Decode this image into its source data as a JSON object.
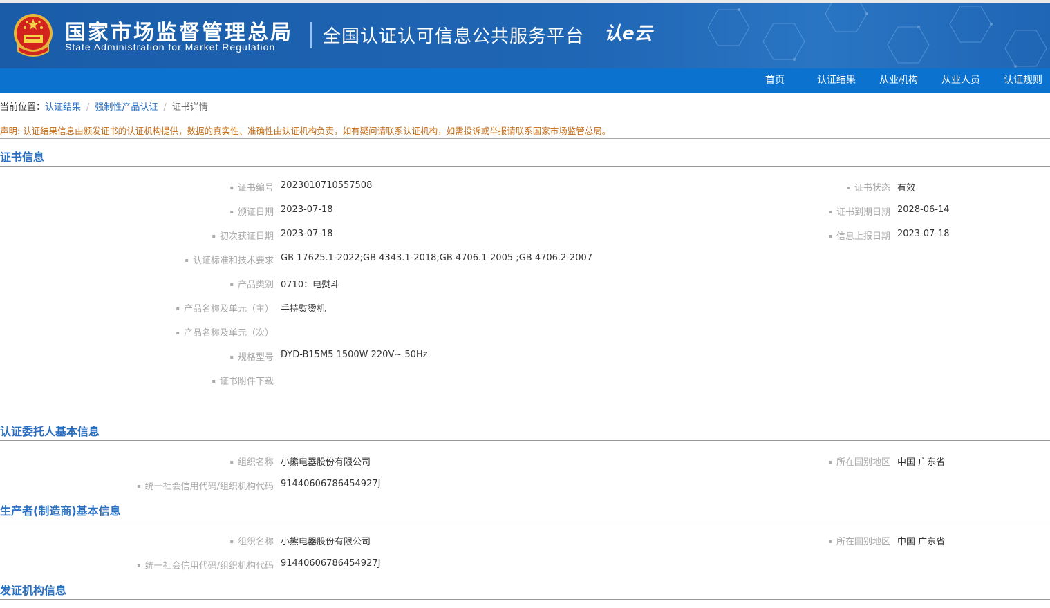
{
  "header": {
    "org_cn": "国家市场监督管理总局",
    "org_en": "State Administration  for  Market Regulation",
    "platform": "全国认证认可信息公共服务平台",
    "logo_text": "认e云"
  },
  "nav": [
    "首页",
    "认证结果",
    "从业机构",
    "从业人员",
    "认证规则"
  ],
  "breadcrumb": {
    "prefix": "当前位置：",
    "items": [
      "认证结果",
      "强制性产品认证",
      "证书详情"
    ]
  },
  "notice": "声明: 认证结果信息由颁发证书的认证机构提供，数据的真实性、准确性由认证机构负责，如有疑问请联系认证机构，如需投诉或举报请联系国家市场监管总局。",
  "cert_section": {
    "title": "证书信息",
    "left": [
      {
        "label": "证书编号",
        "value": "2023010710557508"
      },
      {
        "label": "颁证日期",
        "value": "2023-07-18"
      },
      {
        "label": "初次获证日期",
        "value": "2023-07-18"
      },
      {
        "label": "认证标准和技术要求",
        "value": "GB 17625.1-2022;GB 4343.1-2018;GB 4706.1-2005 ;GB 4706.2-2007"
      },
      {
        "label": "产品类别",
        "value": "0710：电熨斗"
      },
      {
        "label": "产品名称及单元（主）",
        "value": "手持熨烫机"
      },
      {
        "label": "产品名称及单元（次）",
        "value": ""
      },
      {
        "label": "规格型号",
        "value": "DYD-B15M5 1500W 220V~ 50Hz"
      },
      {
        "label": "证书附件下载",
        "value": ""
      }
    ],
    "right": [
      {
        "label": "证书状态",
        "value": "有效"
      },
      {
        "label": "证书到期日期",
        "value": "2028-06-14"
      },
      {
        "label": "信息上报日期",
        "value": "2023-07-18"
      }
    ]
  },
  "client_section": {
    "title": "认证委托人基本信息",
    "org_label": "组织名称",
    "org_value": "小熊电器股份有限公司",
    "region_label": "所在国别地区",
    "region_value": "中国 广东省",
    "code_label": "统一社会信用代码/组织机构代码",
    "code_value": "91440606786454927J"
  },
  "maker_section": {
    "title": "生产者(制造商)基本信息",
    "org_label": "组织名称",
    "org_value": "小熊电器股份有限公司",
    "region_label": "所在国别地区",
    "region_value": "中国 广东省",
    "code_label": "统一社会信用代码/组织机构代码",
    "code_value": "91440606786454927J"
  },
  "issuer_section": {
    "title": "发证机构信息"
  }
}
